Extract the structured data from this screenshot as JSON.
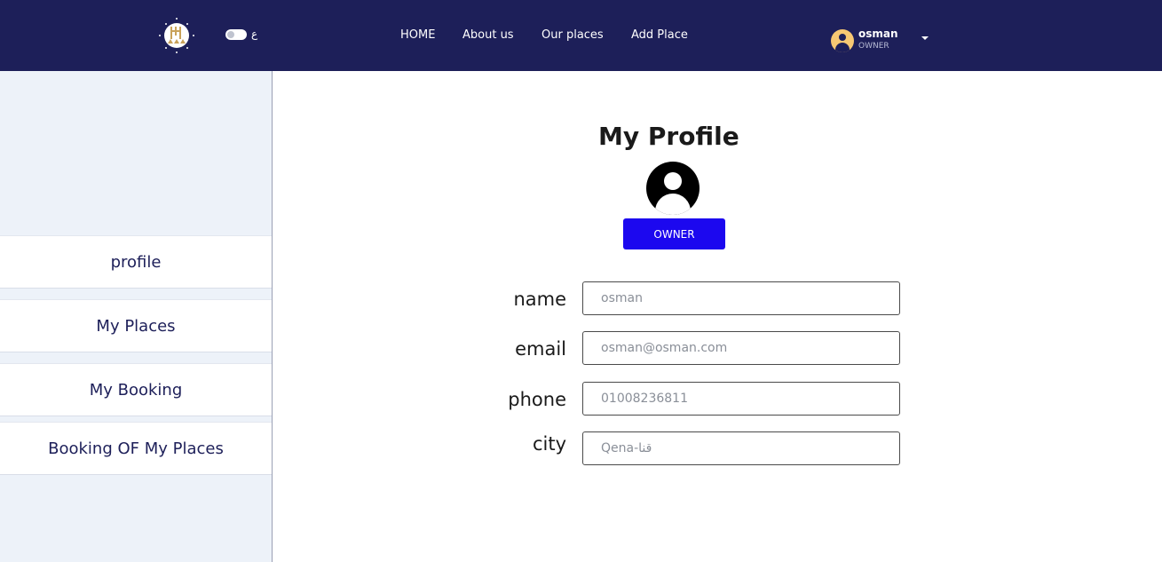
{
  "header": {
    "lang_label": "ع",
    "nav": {
      "home": "HOME",
      "about": "About us",
      "places": "Our places",
      "add": "Add Place"
    },
    "user": {
      "name": "osman",
      "role": "OWNER"
    }
  },
  "sidebar": {
    "items": [
      {
        "label": "profile"
      },
      {
        "label": "My Places"
      },
      {
        "label": "My Booking"
      },
      {
        "label": "Booking OF My Places"
      }
    ]
  },
  "main": {
    "title": "My Profile",
    "role_button": "OWNER",
    "fields": {
      "name": {
        "label": "name",
        "value": "osman"
      },
      "email": {
        "label": "email",
        "value": "osman@osman.com"
      },
      "phone": {
        "label": "phone",
        "value": "01008236811"
      },
      "city": {
        "label": "city",
        "value": "Qena-قنا"
      }
    }
  },
  "colors": {
    "navbar_bg": "#1d1f59",
    "sidebar_bg": "#edf2f9",
    "accent_button": "#1c08ef",
    "avatar_yellow": "#f7c873"
  }
}
